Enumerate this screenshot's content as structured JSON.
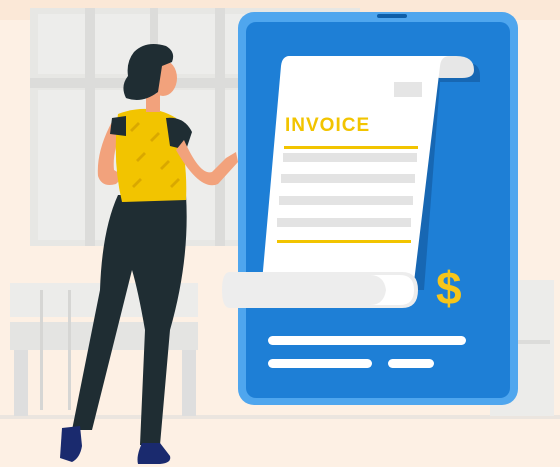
{
  "invoice": {
    "title": "INVOICE",
    "currency_symbol": "$"
  },
  "colors": {
    "background": "#fdf0e4",
    "phone_blue": "#1e7fd6",
    "phone_frame": "#4fa6ee",
    "accent_yellow": "#f2c400",
    "figure_dark": "#1f2d33",
    "skin": "#f2a27c"
  },
  "icons": [
    "dollar-sign-icon",
    "document-scroll-icon"
  ]
}
